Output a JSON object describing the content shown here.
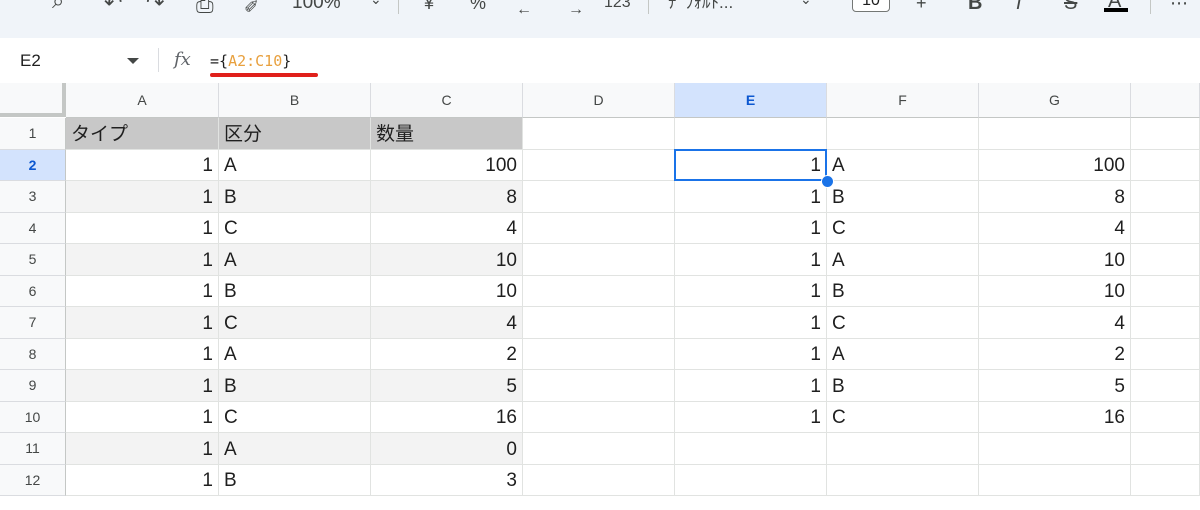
{
  "toolbar": {
    "zoom": "100%",
    "format_more": "123",
    "font_name": "ﾃﾞﾌｫﾙﾄ...",
    "font_size": "10"
  },
  "formula_bar": {
    "name_box": "E2",
    "fx": "fx",
    "formula_prefix": "={",
    "formula_range": "A2:C10",
    "formula_suffix": "}"
  },
  "sheet": {
    "columns": [
      "A",
      "B",
      "C",
      "D",
      "E",
      "F",
      "G"
    ],
    "active_column": "E",
    "active_row": 2,
    "row_numbers": [
      1,
      2,
      3,
      4,
      5,
      6,
      7,
      8,
      9,
      10,
      11,
      12
    ],
    "header_row": [
      "タイプ",
      "区分",
      "数量"
    ],
    "source_rows": [
      [
        "1",
        "A",
        "100"
      ],
      [
        "1",
        "B",
        "8"
      ],
      [
        "1",
        "C",
        "4"
      ],
      [
        "1",
        "A",
        "10"
      ],
      [
        "1",
        "B",
        "10"
      ],
      [
        "1",
        "C",
        "4"
      ],
      [
        "1",
        "A",
        "2"
      ],
      [
        "1",
        "B",
        "5"
      ],
      [
        "1",
        "C",
        "16"
      ],
      [
        "1",
        "A",
        "0"
      ],
      [
        "1",
        "B",
        "3"
      ]
    ],
    "result_rows": [
      [
        "1",
        "A",
        "100"
      ],
      [
        "1",
        "B",
        "8"
      ],
      [
        "1",
        "C",
        "4"
      ],
      [
        "1",
        "A",
        "10"
      ],
      [
        "1",
        "B",
        "10"
      ],
      [
        "1",
        "C",
        "4"
      ],
      [
        "1",
        "A",
        "2"
      ],
      [
        "1",
        "B",
        "5"
      ],
      [
        "1",
        "C",
        "16"
      ]
    ]
  },
  "colors": {
    "selection": "#1a73e8",
    "header_fill": "#c8c8c8",
    "band_fill": "#f3f3f3",
    "formula_range": "#e8a03e",
    "annotation_underline": "#e0201b"
  }
}
